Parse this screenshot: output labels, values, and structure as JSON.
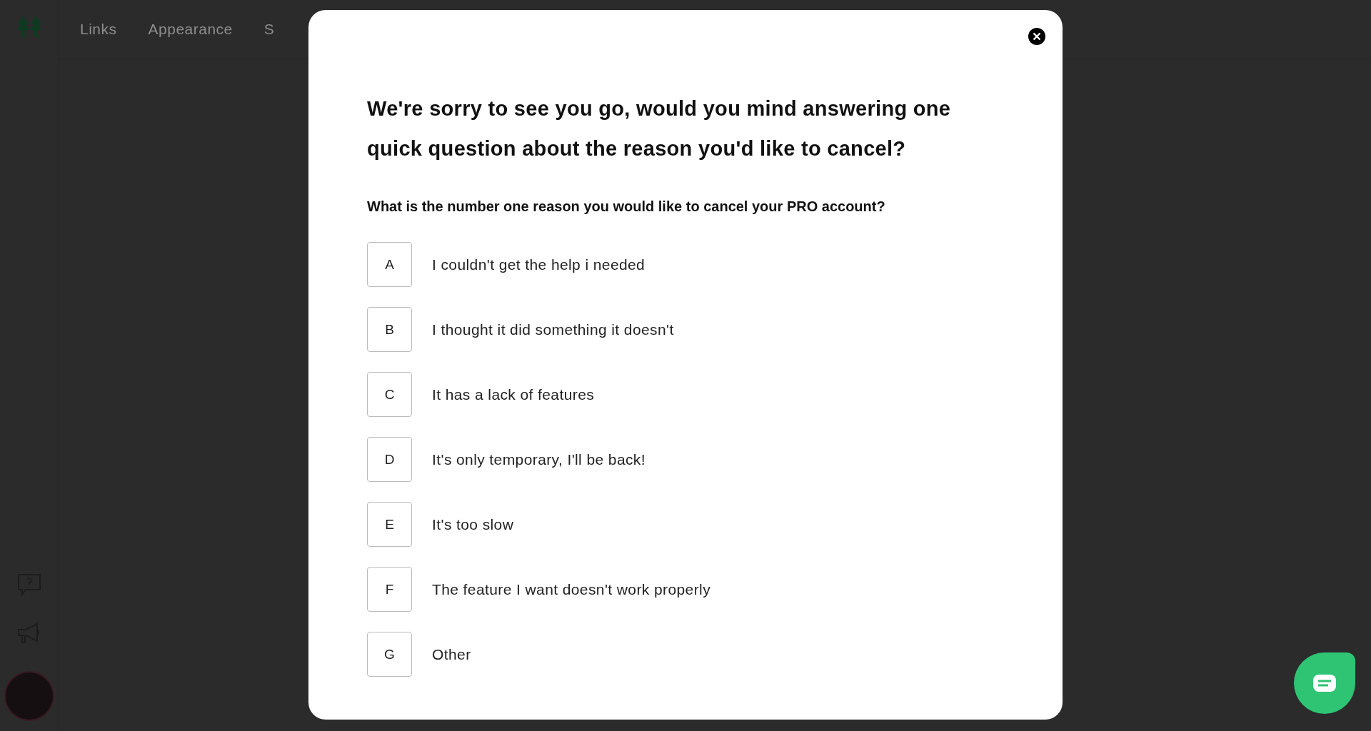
{
  "nav": {
    "items": [
      {
        "label": "Links"
      },
      {
        "label": "Appearance"
      },
      {
        "label": "S"
      }
    ]
  },
  "modal": {
    "title": "We're sorry to see you go, would you mind answering one quick question about the reason you'd like to cancel?",
    "question": "What is the number one reason you would like to cancel your PRO account?",
    "options": [
      {
        "key": "A",
        "label": "I couldn't get the help i needed",
        "selected": false
      },
      {
        "key": "B",
        "label": "I thought it did something it doesn't",
        "selected": false
      },
      {
        "key": "C",
        "label": "It has a lack of features",
        "selected": false
      },
      {
        "key": "D",
        "label": "It's only temporary, I'll be back!",
        "selected": false
      },
      {
        "key": "E",
        "label": "It's too slow",
        "selected": false
      },
      {
        "key": "F",
        "label": "The feature I want doesn't work properly",
        "selected": false
      },
      {
        "key": "G",
        "label": "Other",
        "selected": false
      }
    ]
  }
}
